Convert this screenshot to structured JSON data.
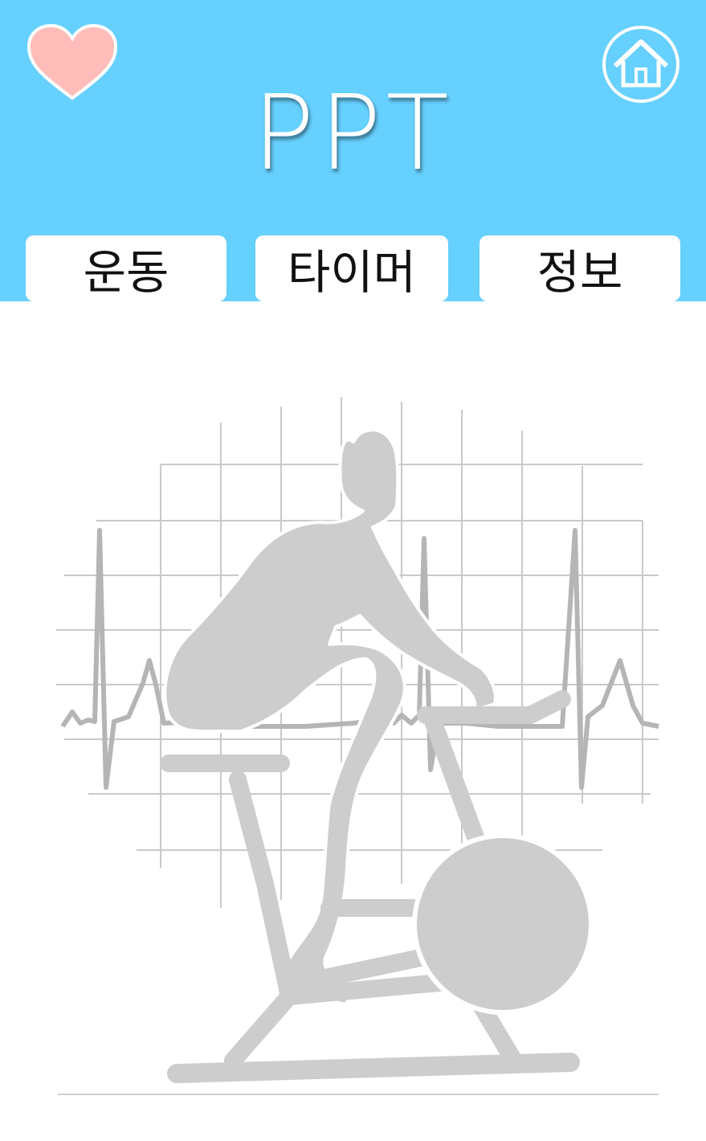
{
  "header": {
    "title": "PPT",
    "background_color": "#66d0fe",
    "favorite_icon": "heart-icon",
    "favorite_color": "#ffbcb8",
    "home_icon": "home-icon"
  },
  "tabs": [
    {
      "label": "운동"
    },
    {
      "label": "타이머"
    },
    {
      "label": "정보"
    }
  ],
  "illustration": {
    "subject": "exercise-bike-rider-with-heartbeat",
    "color": "#c8c8c8"
  }
}
